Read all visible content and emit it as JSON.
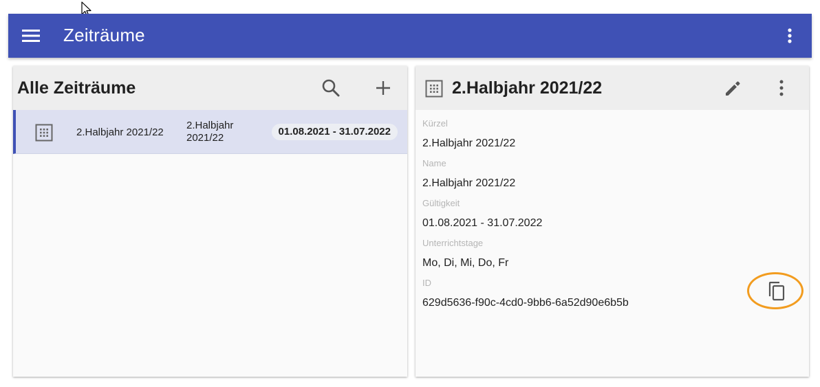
{
  "appbar": {
    "title": "Zeiträume"
  },
  "list_panel": {
    "title": "Alle Zeiträume",
    "items": [
      {
        "kuerzel": "2.Halbjahr 2021/22",
        "name": "2.Halbjahr 2021/22",
        "gueltigkeit": "01.08.2021 - 31.07.2022"
      }
    ]
  },
  "detail_panel": {
    "title": "2.Halbjahr 2021/22",
    "fields": [
      {
        "label": "Kürzel",
        "value": "2.Halbjahr 2021/22"
      },
      {
        "label": "Name",
        "value": "2.Halbjahr 2021/22"
      },
      {
        "label": "Gültigkeit",
        "value": "01.08.2021 - 31.07.2022"
      },
      {
        "label": "Unterrichtstage",
        "value": "Mo, Di, Mi, Do, Fr"
      },
      {
        "label": "ID",
        "value": "629d5636-f90c-4cd0-9bb6-6a52d90e6b5b"
      }
    ]
  },
  "colors": {
    "primary": "#3f51b5",
    "highlight": "#f29c1f",
    "selected_row": "#dde0f1"
  }
}
